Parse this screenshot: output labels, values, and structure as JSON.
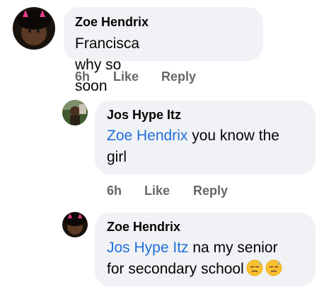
{
  "comments": [
    {
      "author": "Zoe Hendrix",
      "mention": "",
      "text": "Francisca why so soon",
      "time": "6h",
      "like_label": "Like",
      "reply_label": "Reply"
    },
    {
      "author": "Jos Hype Itz",
      "mention": "Zoe Hendrix",
      "text_line1": " you know the",
      "text_line2": "girl",
      "time": "6h",
      "like_label": "Like",
      "reply_label": "Reply"
    },
    {
      "author": "Zoe Hendrix",
      "mention": "Jos Hype Itz",
      "text_line1": " na my senior",
      "text_line2": "for secondary school",
      "emoji": [
        "downcast-face-with-sweat-emoji",
        "downcast-face-with-sweat-emoji"
      ]
    }
  ],
  "colors": {
    "bubble": "#f0f2f5",
    "mention": "#216fdb",
    "action": "#65676b"
  }
}
